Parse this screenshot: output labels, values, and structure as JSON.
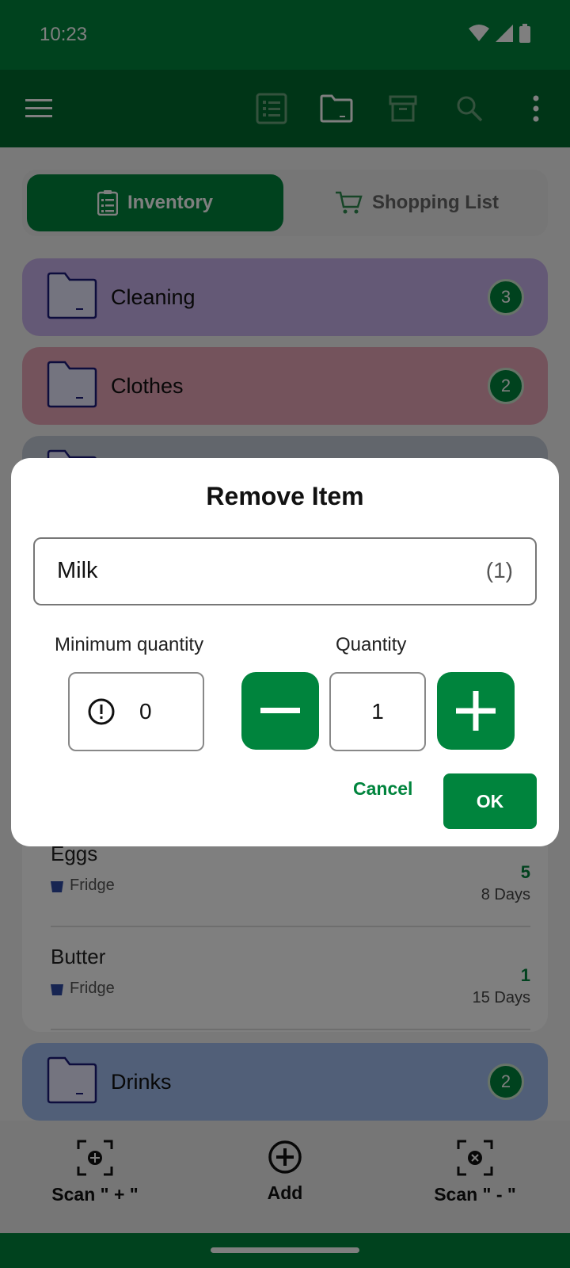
{
  "status_bar": {
    "time": "10:23"
  },
  "app_bar": {
    "icons": [
      "menu-icon",
      "list-icon",
      "folder-icon",
      "archive-icon",
      "search-icon",
      "more-vert-icon"
    ]
  },
  "tabs": {
    "inventory_label": "Inventory",
    "shopping_label": "Shopping List"
  },
  "categories": [
    {
      "name": "Cleaning",
      "count": "3",
      "color": "#c9b3ec"
    },
    {
      "name": "Clothes",
      "count": "2",
      "color": "#e9a7b8"
    },
    {
      "name": "",
      "count": "",
      "color": "#c4ccd8"
    },
    {
      "name": "Drinks",
      "count": "2",
      "color": "#a2bff0"
    }
  ],
  "items": [
    {
      "name": "Eggs",
      "location": "Fridge",
      "quantity": "5",
      "days": "8 Days"
    },
    {
      "name": "Butter",
      "location": "Fridge",
      "quantity": "1",
      "days": "15 Days"
    }
  ],
  "bottom_nav": {
    "scan_add": "Scan \" + \"",
    "add": "Add",
    "scan_remove": "Scan \" - \""
  },
  "dialog": {
    "title": "Remove Item",
    "item_name": "Milk",
    "item_count": "(1)",
    "min_qty_label": "Minimum quantity",
    "min_qty_value": "0",
    "qty_label": "Quantity",
    "qty_value": "1",
    "cancel": "Cancel",
    "ok": "OK"
  },
  "colors": {
    "primary": "#00843d",
    "primary_dark": "#006b2f"
  }
}
